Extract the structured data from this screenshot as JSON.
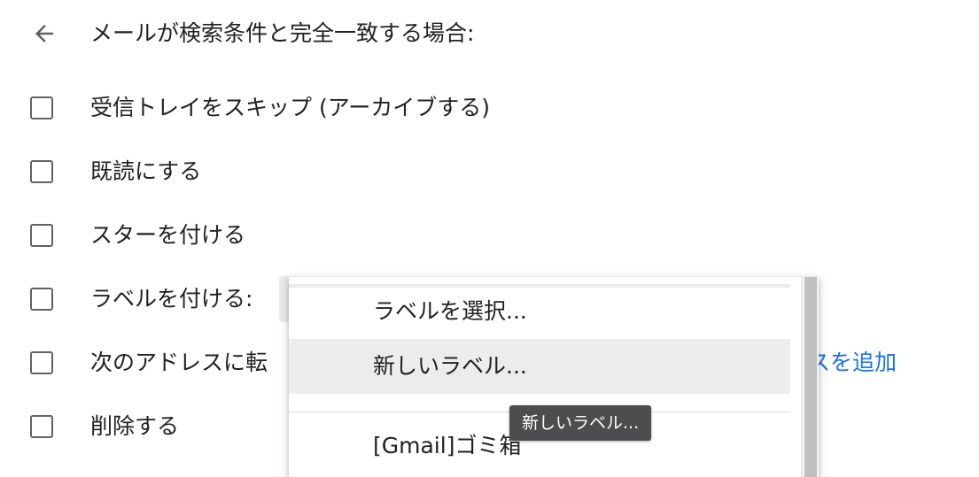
{
  "header": {
    "back_icon": "arrow-left-icon",
    "title": "メールが検索条件と完全一致する場合:"
  },
  "options": [
    {
      "label": "受信トレイをスキップ (アーカイブする)",
      "checked": false
    },
    {
      "label": "既読にする",
      "checked": false
    },
    {
      "label": "スターを付ける",
      "checked": false
    },
    {
      "label": "ラベルを付ける:",
      "checked": false
    },
    {
      "label": "次のアドレスに転",
      "checked": false
    },
    {
      "label": "削除する",
      "checked": false
    }
  ],
  "forward": {
    "add_address_link": "スを追加"
  },
  "label_dropdown": {
    "items": [
      {
        "label": "ラベルを選択...",
        "highlighted": false
      },
      {
        "label": "新しいラベル...",
        "highlighted": true
      },
      {
        "label": "[Gmail]ゴミ箱",
        "highlighted": false
      }
    ]
  },
  "tooltip": {
    "text": "新しいラベル..."
  },
  "colors": {
    "link": "#1a73e8",
    "text": "#202124",
    "checkbox_border": "#5f6368",
    "highlight": "#ececec",
    "tooltip_bg": "#4d4d4f"
  }
}
